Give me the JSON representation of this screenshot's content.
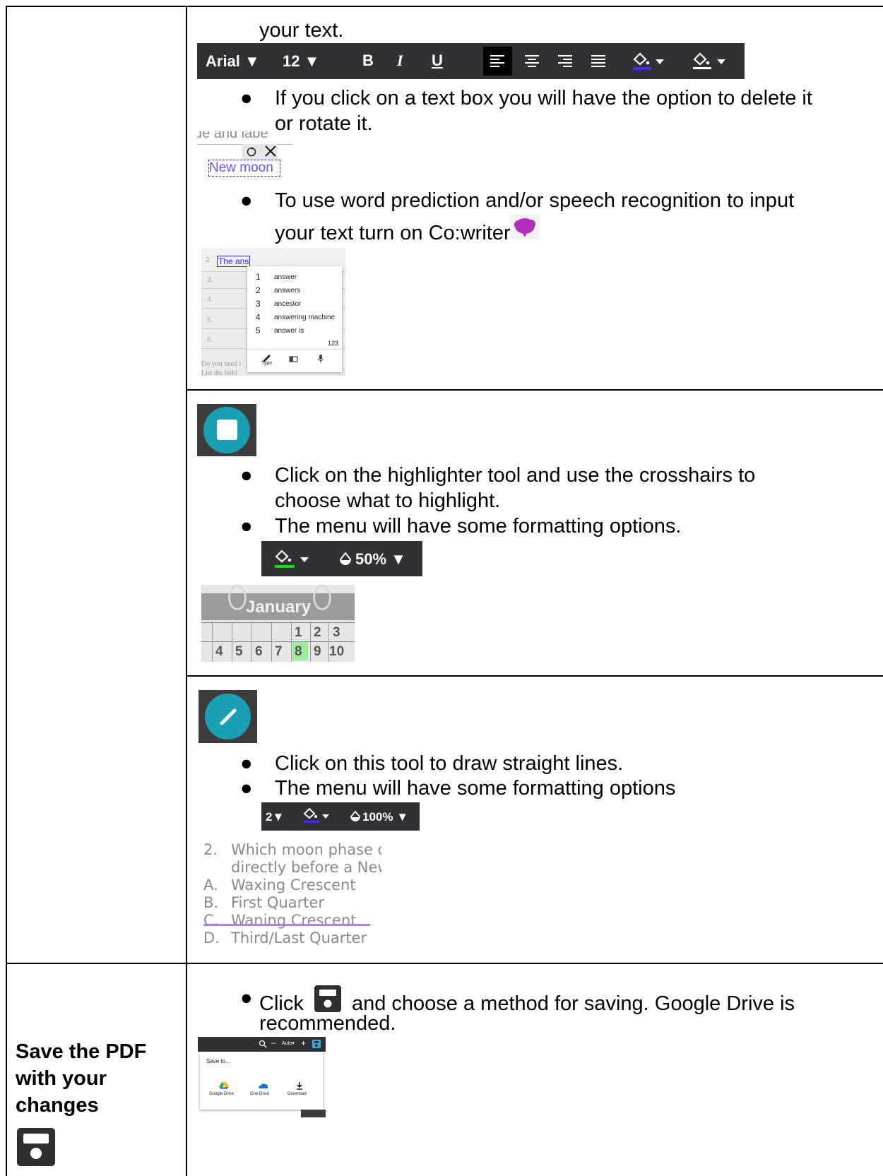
{
  "intro": {
    "line": "your text."
  },
  "text_toolbar": {
    "font": "Arial",
    "size": "12",
    "bold": "B",
    "italic": "I",
    "underline": "U",
    "colors": {
      "text_fill": "#4a2cf5",
      "bg": "#303134"
    }
  },
  "textbox_section": {
    "bullet": "If you click on a text box you will have the option to delete it",
    "bullet_cont": "or rotate it.",
    "demo_partial": "de and labe",
    "demo_label": "New moon"
  },
  "cowriter_section": {
    "bullet": "To use word prediction and/or speech recognition to input",
    "bullet_cont": "your text turn on Co:writer",
    "row_label": "The ans",
    "rows": [
      "2.",
      "3.",
      "4.",
      "5.",
      "6."
    ],
    "suggestions": [
      {
        "n": "1",
        "word": "answer"
      },
      {
        "n": "2",
        "word": "answers"
      },
      {
        "n": "3",
        "word": "ancestor"
      },
      {
        "n": "4",
        "word": "answering machine"
      },
      {
        "n": "5",
        "word": "answer is"
      }
    ],
    "more": "123",
    "type_label": "Type",
    "footer_text": "Do you need t",
    "footer_text2": "List the hidd"
  },
  "highlighter_section": {
    "bullet1": "Click on the highlighter tool and use the crosshairs to",
    "bullet1_cont": "choose what to highlight.",
    "bullet2": "The menu will have some formatting options.",
    "opacity": "50%",
    "color": "#1fd01f",
    "calendar": {
      "title": "January",
      "row1": [
        "",
        "",
        "",
        "",
        "1",
        "2",
        "3"
      ],
      "row2": [
        "4",
        "5",
        "6",
        "7",
        "8",
        "9",
        "10"
      ]
    }
  },
  "line_section": {
    "bullet1": "Click on this tool to draw straight lines.",
    "bullet2": "The menu will have some formatting options",
    "width": "2",
    "opacity": "100%",
    "question": [
      {
        "n": "2.",
        "text": "Which moon phase occurs"
      },
      {
        "n": "",
        "text": "directly before a New Moon?"
      },
      {
        "n": "A.",
        "text": "Waxing Crescent"
      },
      {
        "n": "B.",
        "text": "First Quarter"
      },
      {
        "n": "C.",
        "text": "Waning Crescent"
      },
      {
        "n": "D.",
        "text": "Third/Last Quarter"
      }
    ]
  },
  "save_section": {
    "title_line1": "Save the PDF",
    "title_line2": "with your",
    "title_line3": "changes",
    "bullet_pre": "Click",
    "bullet_post": "and choose a method for saving.  Google Drive is",
    "bullet_cont": "recommended.",
    "zoom": "Auto",
    "save_to": "Save to...",
    "options": [
      "Google Drive",
      "One Drive",
      "Download"
    ]
  }
}
